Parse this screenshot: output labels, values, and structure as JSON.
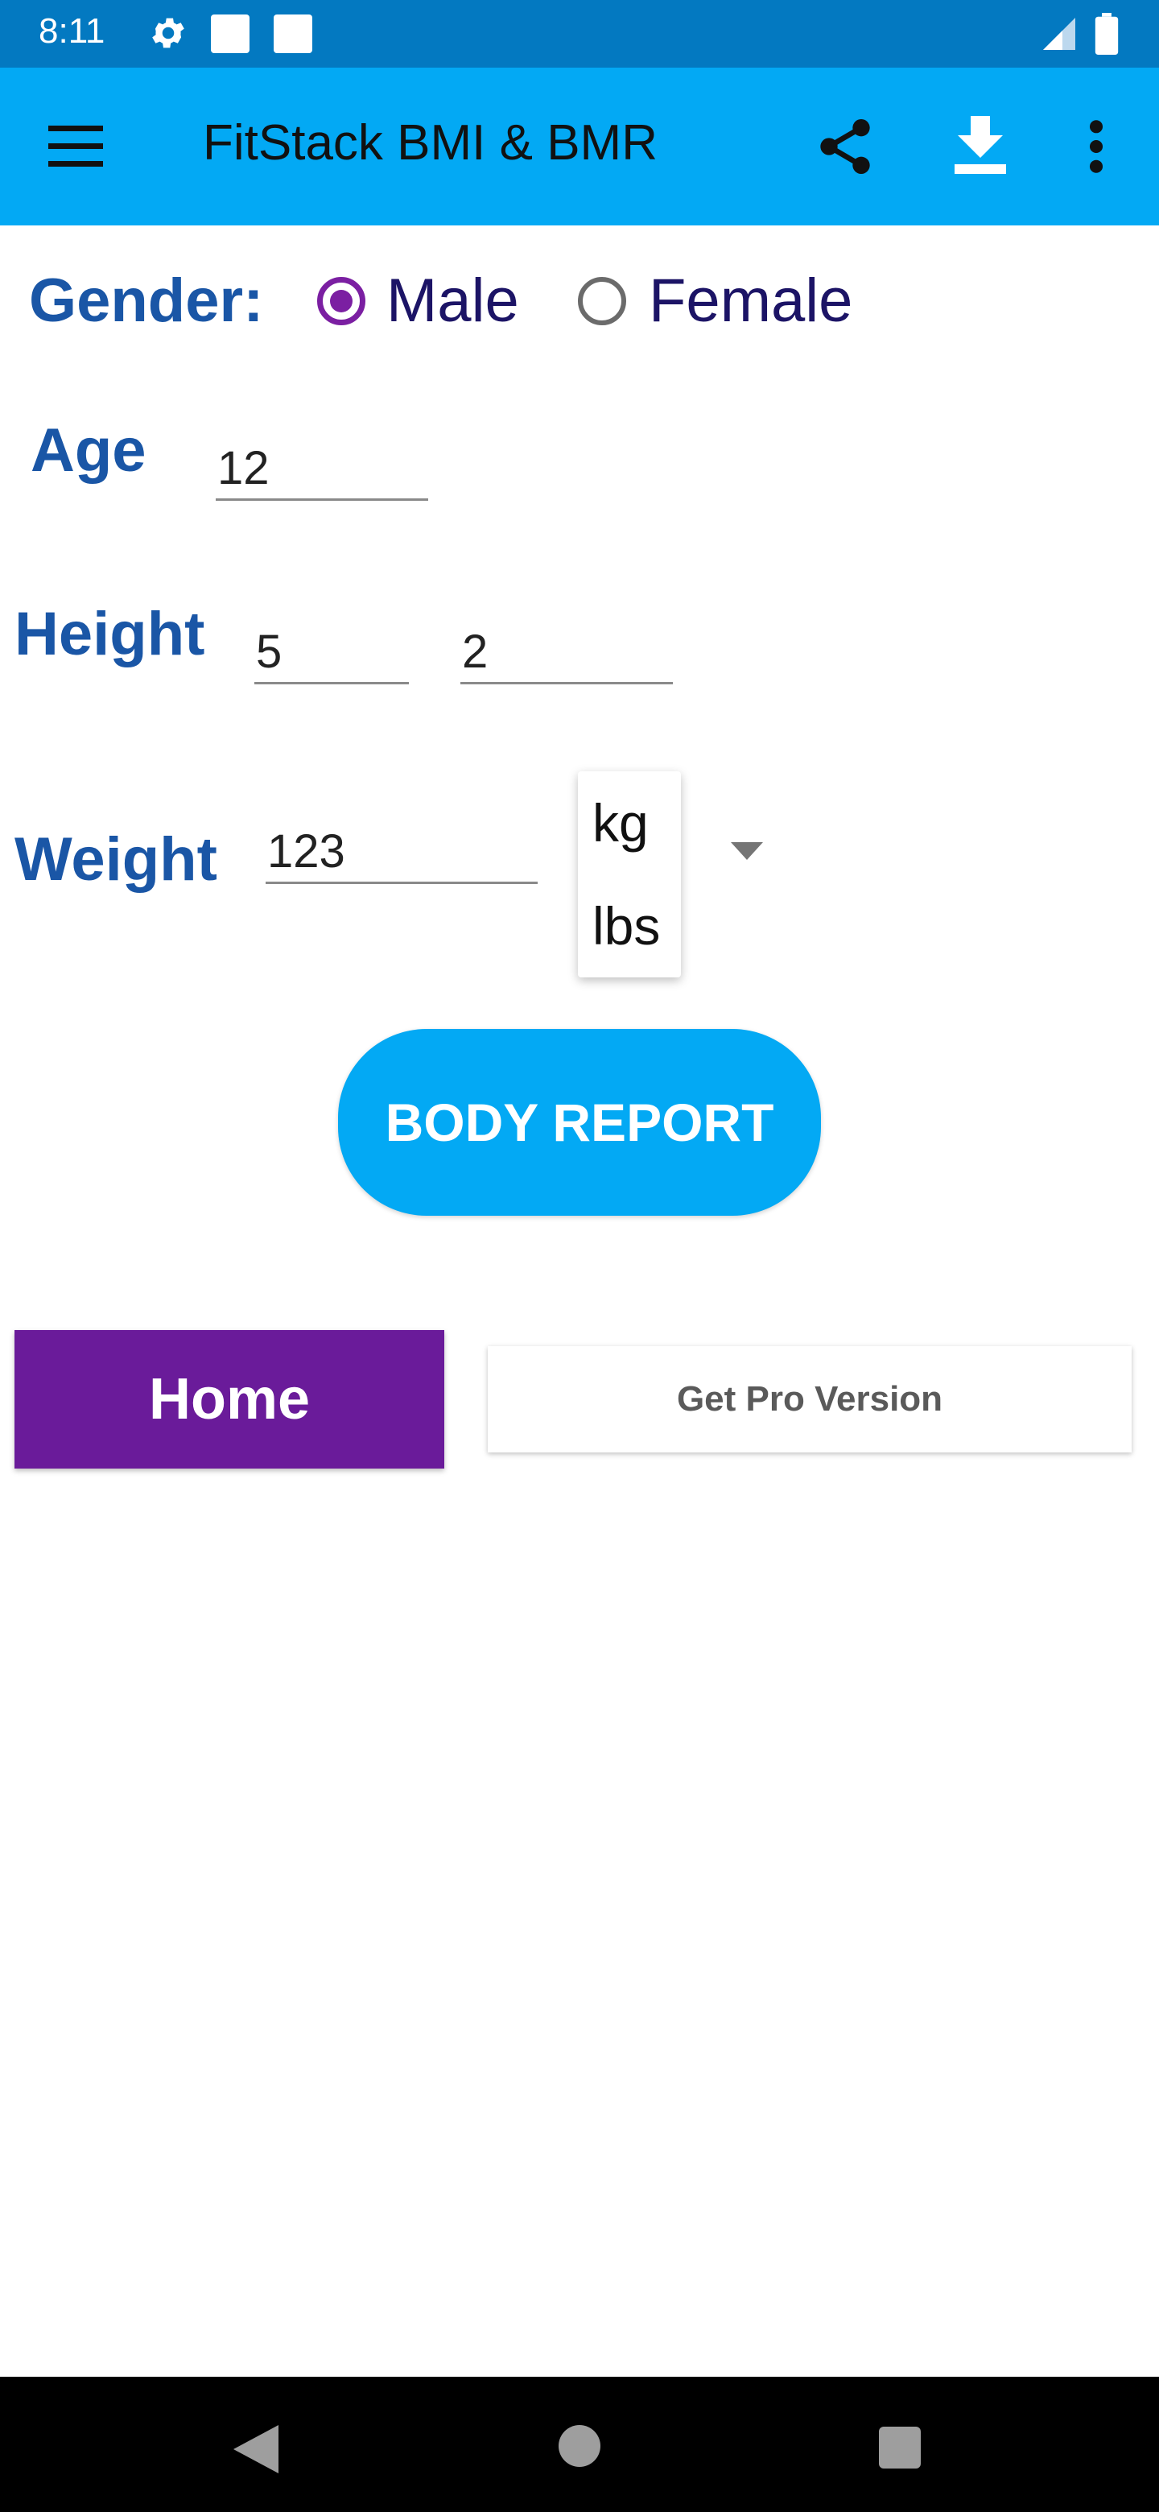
{
  "status_bar": {
    "time": "8:11",
    "icons": [
      "gear-icon",
      "notification-square-icon",
      "notification-square-icon",
      "signal-icon",
      "battery-icon"
    ]
  },
  "app_bar": {
    "title": "FitStack BMI & BMR",
    "icons": [
      "menu-icon",
      "share-icon",
      "download-icon",
      "more-vert-icon"
    ]
  },
  "form": {
    "gender": {
      "label": "Gender:",
      "options": [
        {
          "label": "Male",
          "selected": true
        },
        {
          "label": "Female",
          "selected": false
        }
      ]
    },
    "age": {
      "label": "Age",
      "value": "12"
    },
    "height": {
      "label": "Height",
      "feet": "5",
      "inches": "2"
    },
    "weight": {
      "label": "Weight",
      "value": "123",
      "unit_options": [
        "kg",
        "lbs"
      ]
    }
  },
  "actions": {
    "report_label": "BODY REPORT",
    "home_label": "Home",
    "pro_label": "Get Pro Version"
  },
  "colors": {
    "status_bar": "#0379c1",
    "app_bar": "#03a9f4",
    "label_blue": "#1a56a6",
    "radio_purple": "#7b1fa2",
    "home_purple": "#6a1b9a",
    "nav_bar": "#000000"
  }
}
